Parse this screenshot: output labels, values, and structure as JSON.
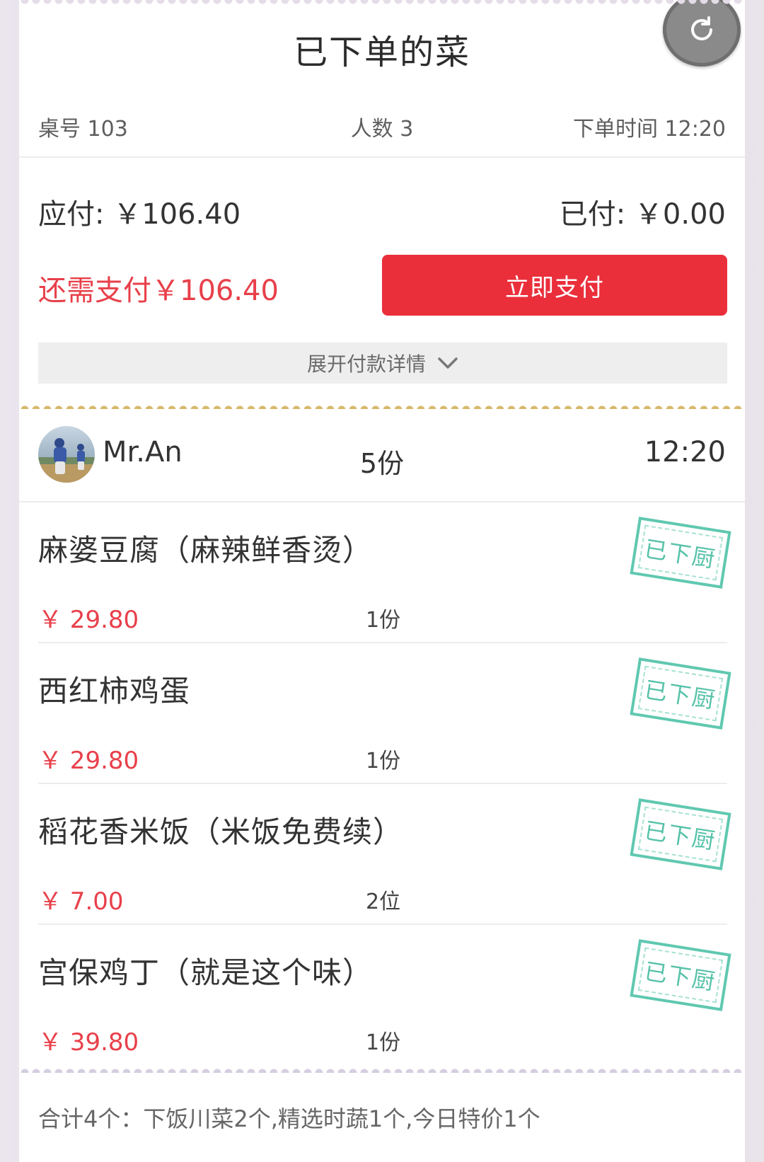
{
  "header": {
    "title": "已下单的菜",
    "refresh_icon": "refresh-icon",
    "table_no": "桌号 103",
    "people": "人数 3",
    "order_time": "下单时间 12:20"
  },
  "payment": {
    "due": "应付: ￥106.40",
    "paid": "已付: ￥0.00",
    "remaining": "还需支付￥106.40",
    "pay_button": "立即支付",
    "expand_label": "展开付款详情"
  },
  "order_user": {
    "name": "Mr.An",
    "count": "5份",
    "time": "12:20"
  },
  "items": [
    {
      "name": "麻婆豆腐（麻辣鲜香烫）",
      "price": "￥ 29.80",
      "qty": "1份",
      "status": "已下厨"
    },
    {
      "name": "西红柿鸡蛋",
      "price": "￥ 29.80",
      "qty": "1份",
      "status": "已下厨"
    },
    {
      "name": "稻花香米饭（米饭免费续）",
      "price": "￥ 7.00",
      "qty": "2位",
      "status": "已下厨"
    },
    {
      "name": "宫保鸡丁（就是这个味）",
      "price": "￥ 39.80",
      "qty": "1份",
      "status": "已下厨"
    }
  ],
  "summary": "合计4个：下饭川菜2个,精选时蔬1个,今日特价1个",
  "colors": {
    "accent_red": "#ea2f3b",
    "price_red": "#e8404a",
    "stamp_green": "#45bca0"
  }
}
